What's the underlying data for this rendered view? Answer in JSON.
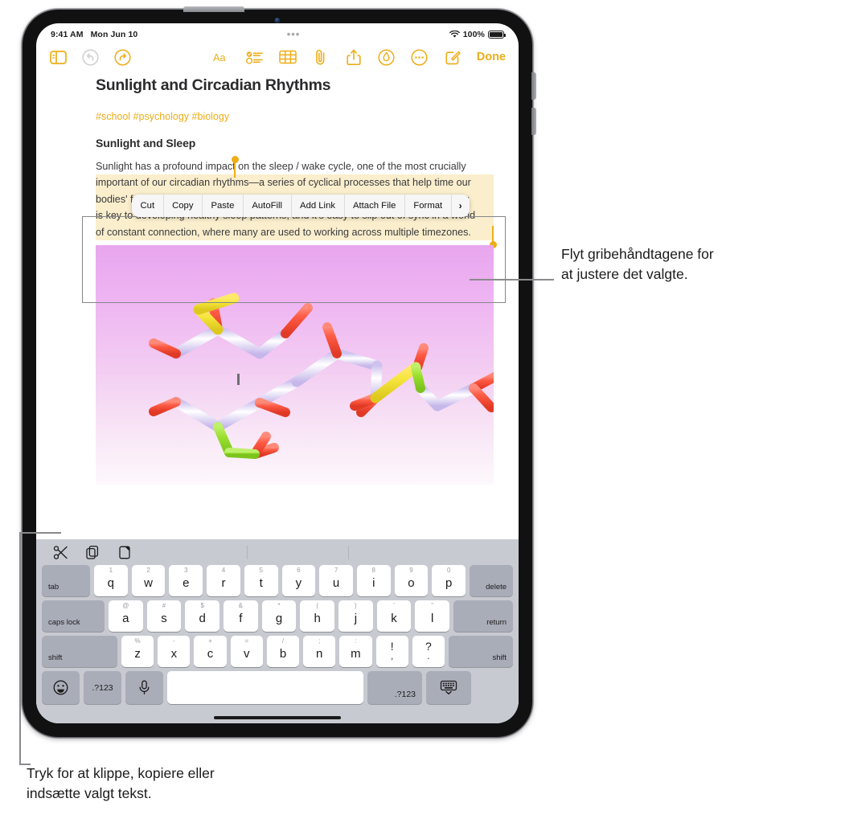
{
  "status_bar": {
    "time": "9:41 AM",
    "date": "Mon Jun 10",
    "center_dots": "•••",
    "battery_percent": "100%",
    "wifi_icon": "wifi-icon",
    "battery_icon": "battery-full-icon"
  },
  "toolbar": {
    "sidebar_icon": "sidebar-icon",
    "undo_icon": "undo-icon",
    "redo_icon": "redo-icon",
    "format_icon": "format-aa-icon",
    "checklist_icon": "checklist-icon",
    "table_icon": "table-icon",
    "attach_icon": "paperclip-icon",
    "share_icon": "share-icon",
    "markup_icon": "markup-pen-icon",
    "more_icon": "more-ellipsis-icon",
    "compose_icon": "compose-icon",
    "done_label": "Done"
  },
  "note": {
    "title": "Sunlight and Circadian Rhythms",
    "tags": "#school #psychology #biology",
    "subheading": "Sunlight and Sleep",
    "paragraph_lines": [
      {
        "text": "Sunlight has a profound impact on the sleep / wake cycle, one of the most crucially",
        "highlighted": false,
        "lead": "Sunlight"
      },
      {
        "text": "important of our circadian rhythms—a series of cyclical processes that help time our",
        "highlighted": true
      },
      {
        "text": "bodies' functions to optimize everything from wakefulness to digestion. Consistency",
        "highlighted": true
      },
      {
        "text": "is key to developing healthy sleep patterns, and it's easy to slip out of sync in a world",
        "highlighted": true
      },
      {
        "text": "of constant connection, where many are used to working across multiple timezones.",
        "highlighted": true
      }
    ],
    "highlight_color": "#faeecd",
    "handle_color": "#eead16",
    "image_alt": "molecule-3d-render"
  },
  "context_menu": {
    "items": [
      {
        "label": "Cut"
      },
      {
        "label": "Copy"
      },
      {
        "label": "Paste"
      },
      {
        "label": "AutoFill"
      },
      {
        "label": "Add Link"
      },
      {
        "label": "Attach File"
      },
      {
        "label": "Format"
      },
      {
        "label": "›"
      }
    ]
  },
  "keyboard": {
    "shortcut_bar": {
      "cut_icon": "scissors-icon",
      "copy_icon": "copy-icon",
      "paste_icon": "paste-icon"
    },
    "row1": {
      "tab": "tab",
      "keys": [
        {
          "main": "q",
          "alt": "1"
        },
        {
          "main": "w",
          "alt": "2"
        },
        {
          "main": "e",
          "alt": "3"
        },
        {
          "main": "r",
          "alt": "4"
        },
        {
          "main": "t",
          "alt": "5"
        },
        {
          "main": "y",
          "alt": "6"
        },
        {
          "main": "u",
          "alt": "7"
        },
        {
          "main": "i",
          "alt": "8"
        },
        {
          "main": "o",
          "alt": "9"
        },
        {
          "main": "p",
          "alt": "0"
        }
      ],
      "delete": "delete"
    },
    "row2": {
      "caps_lock": "caps lock",
      "keys": [
        {
          "main": "a",
          "alt": "@"
        },
        {
          "main": "s",
          "alt": "#"
        },
        {
          "main": "d",
          "alt": "$"
        },
        {
          "main": "f",
          "alt": "&"
        },
        {
          "main": "g",
          "alt": "*"
        },
        {
          "main": "h",
          "alt": "("
        },
        {
          "main": "j",
          "alt": ")"
        },
        {
          "main": "k",
          "alt": "'"
        },
        {
          "main": "l",
          "alt": "\""
        }
      ],
      "return": "return"
    },
    "row3": {
      "shift_left": "shift",
      "keys": [
        {
          "main": "z",
          "alt": "%"
        },
        {
          "main": "x",
          "alt": "-"
        },
        {
          "main": "c",
          "alt": "+"
        },
        {
          "main": "v",
          "alt": "="
        },
        {
          "main": "b",
          "alt": "/"
        },
        {
          "main": "n",
          "alt": ";"
        },
        {
          "main": "m",
          "alt": ":"
        },
        {
          "main": "!",
          "sub": ",",
          "alt": ""
        },
        {
          "main": "?",
          "sub": ".",
          "alt": ""
        }
      ],
      "shift_right": "shift"
    },
    "row4": {
      "emoji_icon": "emoji-smiley-icon",
      "numbers_left": ".?123",
      "mic_icon": "microphone-icon",
      "space": "",
      "numbers_right": ".?123",
      "hide_keyboard_icon": "hide-keyboard-icon"
    }
  },
  "callouts": [
    {
      "id": "handles",
      "line1": "Flyt gribehåndtagene for",
      "line2": "at justere det valgte."
    },
    {
      "id": "shortcuts",
      "line1": "Tryk for at klippe, kopiere eller",
      "line2": "indsætte valgt tekst."
    }
  ],
  "colors": {
    "accent": "#eead16",
    "highlight": "#faeecd",
    "keyboard_bg": "#c8cad1",
    "callout_line": "#8a8a8e"
  }
}
